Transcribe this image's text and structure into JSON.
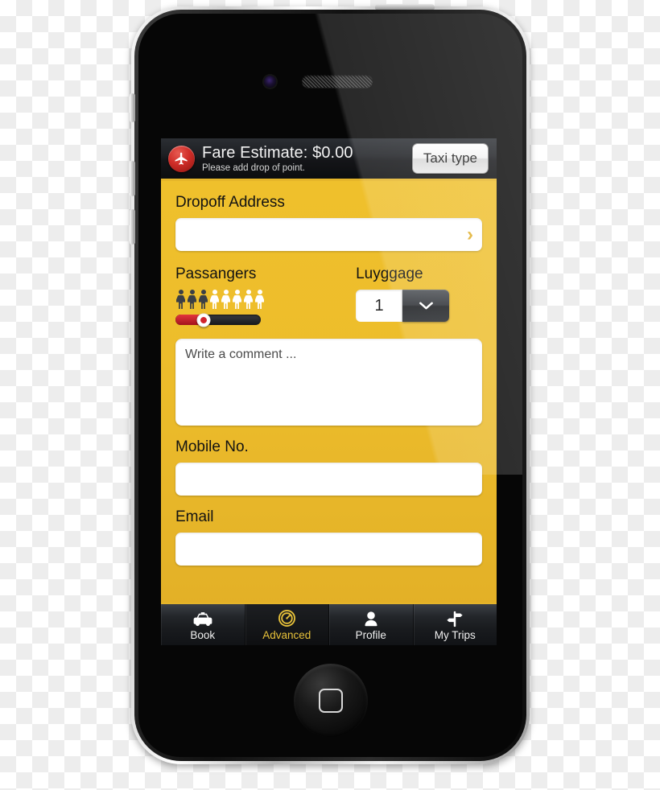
{
  "device": {
    "name": "iphone-4",
    "home_button": "home-button",
    "camera": "front-camera",
    "speaker": "earpiece-speaker"
  },
  "header": {
    "badge_icon": "airplane-icon",
    "title": "Fare Estimate: $0.00",
    "subtitle": "Please add drop of point.",
    "taxi_type_label": "Taxi type"
  },
  "form": {
    "dropoff": {
      "label": "Dropoff Address",
      "value": "",
      "placeholder": "",
      "chevron_icon": "chevron-right-icon"
    },
    "passengers": {
      "label": "Passangers",
      "total_icons": 8,
      "selected": 3,
      "slider_percent": 33
    },
    "luggage": {
      "label": "Luyggage",
      "value": "1",
      "chevron_icon": "chevron-down-icon"
    },
    "comment": {
      "placeholder": "Write a comment ...",
      "value": ""
    },
    "mobile": {
      "label": "Mobile No.",
      "value": "",
      "placeholder": ""
    },
    "email": {
      "label": "Email",
      "value": "",
      "placeholder": ""
    }
  },
  "tabbar": {
    "items": [
      {
        "label": "Book",
        "icon": "taxi-icon",
        "active": false
      },
      {
        "label": "Advanced",
        "icon": "gauge-icon",
        "active": true
      },
      {
        "label": "Profile",
        "icon": "person-icon",
        "active": false
      },
      {
        "label": "My Trips",
        "icon": "signpost-icon",
        "active": false
      }
    ]
  },
  "colors": {
    "accent_yellow": "#EEBE2B",
    "accent_yellow_dark": "#E1AE26",
    "header_dark": "#1C1E22",
    "badge_red": "#CF2D28",
    "slider_red": "#C11F28",
    "tab_active_text": "#E8C23A"
  }
}
